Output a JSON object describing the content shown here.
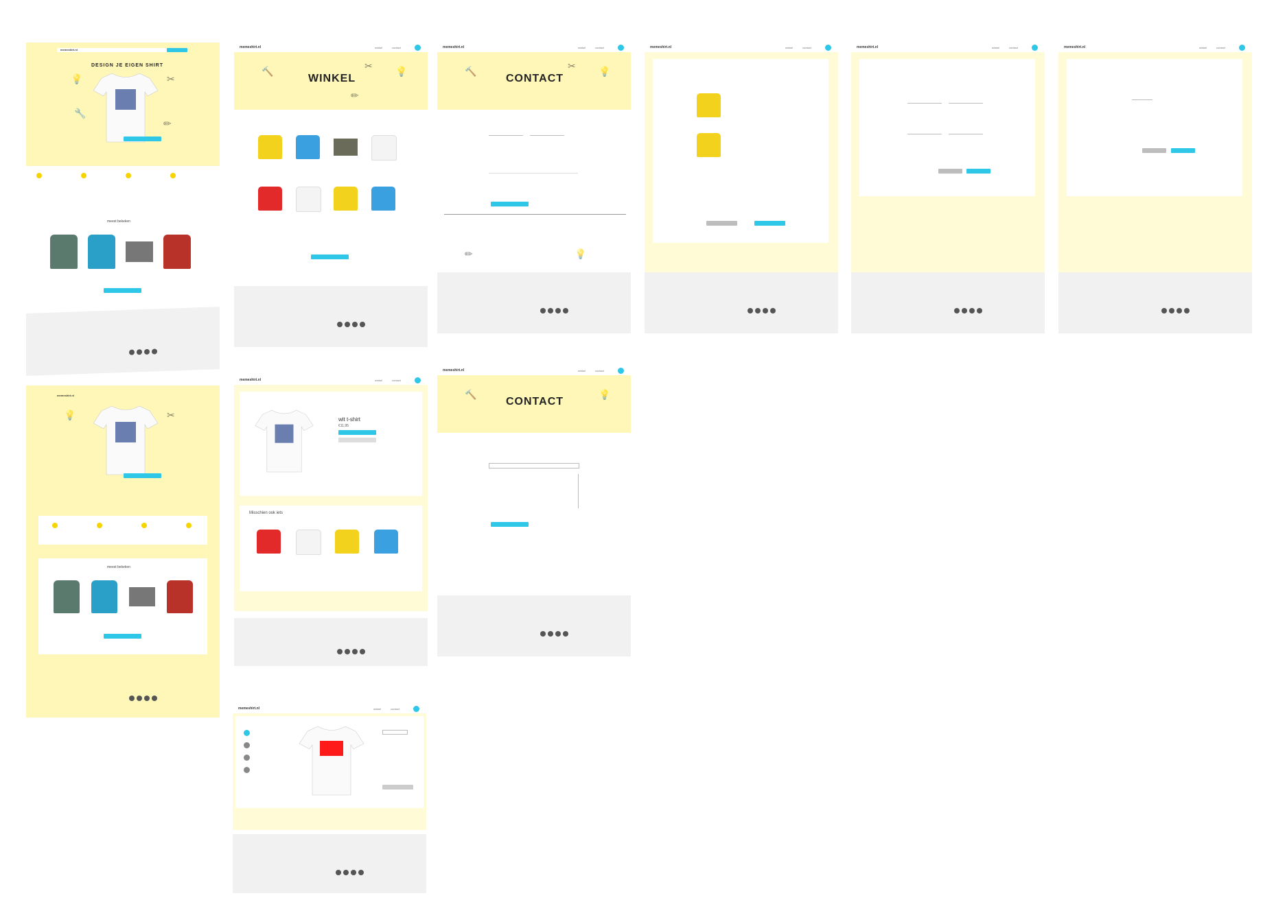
{
  "brand": {
    "logo_text": "memeshirt.nl",
    "accent_color": "#2ec7e8",
    "yellow_color": "#fff7b8"
  },
  "nav": {
    "items": [
      "winkel",
      "contact"
    ]
  },
  "home": {
    "title": "DESIGN JE EIGEN SHIRT",
    "meest_bekeken": "meest bekeken"
  },
  "winkel": {
    "title": "WINKEL"
  },
  "contact": {
    "title": "CONTACT"
  },
  "product": {
    "name": "wit t-shirt",
    "price": "€11,95",
    "other_heading": "Misschien ook iets"
  },
  "footer": {
    "social_icons": [
      "facebook-icon",
      "twitter-icon",
      "instagram-icon",
      "pinterest-icon"
    ]
  }
}
